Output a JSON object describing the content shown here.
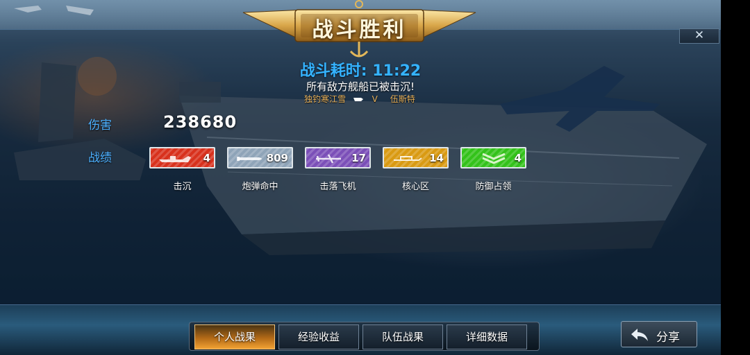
{
  "header": {
    "title": "战斗胜利",
    "close_label": "✕"
  },
  "summary": {
    "duration": "战斗耗时: 11:22",
    "subtitle": "所有敌方舰船已被击沉!",
    "player_left": "独钓寒江雪",
    "vs": "V",
    "player_right": "伍斯特"
  },
  "labels": {
    "damage": "伤害",
    "record": "战绩"
  },
  "damage_value": "238680",
  "stats": [
    {
      "name": "击沉",
      "value": "4",
      "color": "#d8311d",
      "icon": "ship-icon"
    },
    {
      "name": "炮弹命中",
      "value": "809",
      "color": "#8fa4b8",
      "icon": "shell-icon"
    },
    {
      "name": "击落飞机",
      "value": "17",
      "color": "#7b4fb8",
      "icon": "plane-icon"
    },
    {
      "name": "核心区",
      "value": "14",
      "color": "#d99a12",
      "icon": "core-icon"
    },
    {
      "name": "防御占领",
      "value": "4",
      "color": "#33c21a",
      "icon": "chevron-icon"
    }
  ],
  "tabs": [
    {
      "label": "个人战果",
      "active": true
    },
    {
      "label": "经验收益",
      "active": false
    },
    {
      "label": "队伍战果",
      "active": false
    },
    {
      "label": "详细数据",
      "active": false
    }
  ],
  "share_label": "分享"
}
